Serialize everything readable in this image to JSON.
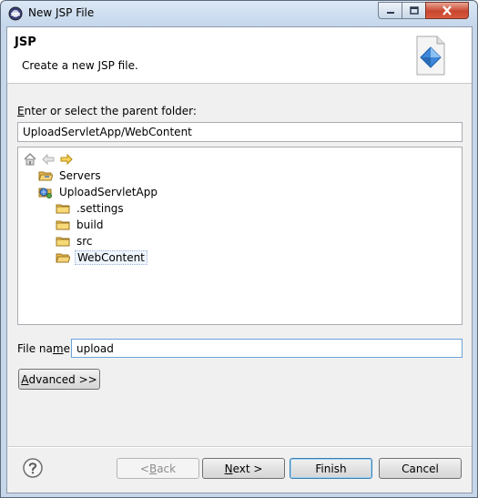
{
  "window": {
    "title": "New JSP File"
  },
  "header": {
    "title": "JSP",
    "description": "Create a new JSP file."
  },
  "parent_folder": {
    "label_prefix": "",
    "label_mnemonic": "E",
    "label_rest": "nter or select the parent folder:",
    "value": "UploadServletApp/WebContent"
  },
  "tree": {
    "toolbar": [
      {
        "icon": "home-icon"
      },
      {
        "icon": "back-arrow-icon"
      },
      {
        "icon": "forward-arrow-icon"
      }
    ],
    "items": [
      {
        "label": "Servers",
        "icon": "folder-open-icon",
        "level": 0
      },
      {
        "label": "UploadServletApp",
        "icon": "web-project-icon",
        "level": 0
      },
      {
        "label": ".settings",
        "icon": "folder-icon",
        "level": 1
      },
      {
        "label": "build",
        "icon": "folder-icon",
        "level": 1
      },
      {
        "label": "src",
        "icon": "folder-icon",
        "level": 1
      },
      {
        "label": "WebContent",
        "icon": "folder-open-icon",
        "level": 1,
        "selected": true
      }
    ]
  },
  "file_name": {
    "label_prefix": "File na",
    "label_mnemonic": "m",
    "label_rest": "e:",
    "value": "upload"
  },
  "buttons": {
    "advanced_mnemonic": "A",
    "advanced_rest": "dvanced >>",
    "back_prefix": "< ",
    "back_mnemonic": "B",
    "back_rest": "ack",
    "next_mnemonic": "N",
    "next_rest": "ext >",
    "finish": "Finish",
    "cancel": "Cancel"
  },
  "colors": {
    "folder": "#e8b94a",
    "accent": "#3c7fb1"
  }
}
